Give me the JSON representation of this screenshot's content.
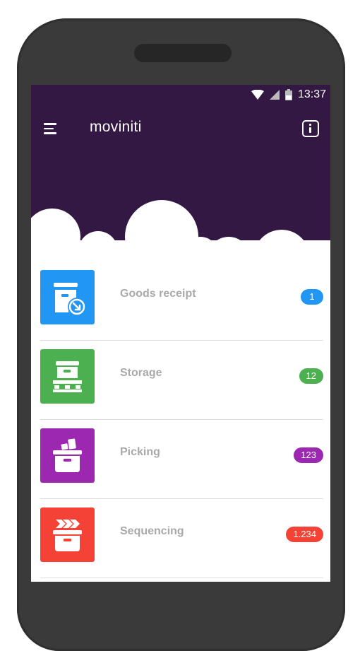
{
  "status": {
    "time": "13:37"
  },
  "app": {
    "title": "moviniti"
  },
  "menu": [
    {
      "label": "Goods receipt",
      "badge": "1",
      "color": "#2196F3",
      "icon": "goods-receipt-icon"
    },
    {
      "label": "Storage",
      "badge": "12",
      "color": "#4CAF50",
      "icon": "storage-pallet-icon"
    },
    {
      "label": "Picking",
      "badge": "123",
      "color": "#9C27B0",
      "icon": "picking-box-icon"
    },
    {
      "label": "Sequencing",
      "badge": "1.234",
      "color": "#F44336",
      "icon": "sequencing-icon"
    }
  ],
  "colors": {
    "header": "#321843",
    "device": "#3a3a3a"
  }
}
